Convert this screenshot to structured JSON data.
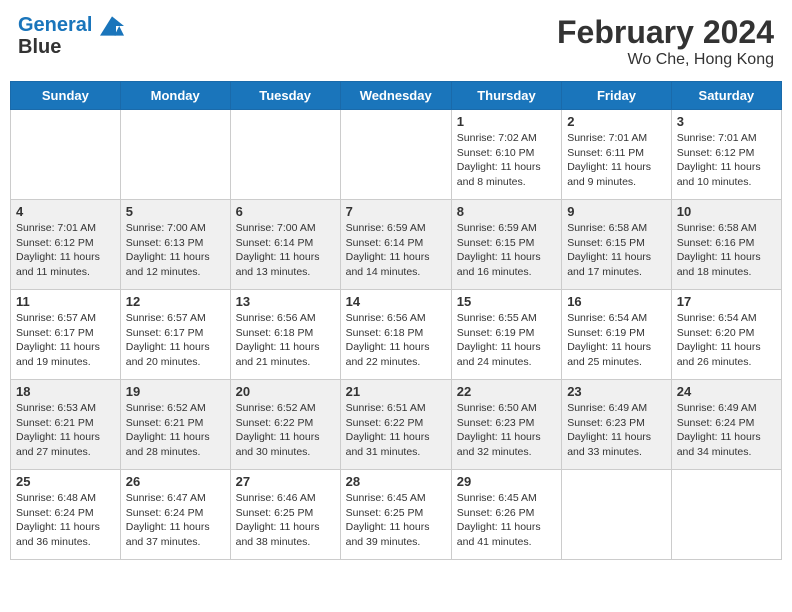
{
  "header": {
    "logo_line1": "General",
    "logo_line2": "Blue",
    "month_year": "February 2024",
    "location": "Wo Che, Hong Kong"
  },
  "days_of_week": [
    "Sunday",
    "Monday",
    "Tuesday",
    "Wednesday",
    "Thursday",
    "Friday",
    "Saturday"
  ],
  "weeks": [
    [
      {
        "num": "",
        "info": ""
      },
      {
        "num": "",
        "info": ""
      },
      {
        "num": "",
        "info": ""
      },
      {
        "num": "",
        "info": ""
      },
      {
        "num": "1",
        "info": "Sunrise: 7:02 AM\nSunset: 6:10 PM\nDaylight: 11 hours\nand 8 minutes."
      },
      {
        "num": "2",
        "info": "Sunrise: 7:01 AM\nSunset: 6:11 PM\nDaylight: 11 hours\nand 9 minutes."
      },
      {
        "num": "3",
        "info": "Sunrise: 7:01 AM\nSunset: 6:12 PM\nDaylight: 11 hours\nand 10 minutes."
      }
    ],
    [
      {
        "num": "4",
        "info": "Sunrise: 7:01 AM\nSunset: 6:12 PM\nDaylight: 11 hours\nand 11 minutes."
      },
      {
        "num": "5",
        "info": "Sunrise: 7:00 AM\nSunset: 6:13 PM\nDaylight: 11 hours\nand 12 minutes."
      },
      {
        "num": "6",
        "info": "Sunrise: 7:00 AM\nSunset: 6:14 PM\nDaylight: 11 hours\nand 13 minutes."
      },
      {
        "num": "7",
        "info": "Sunrise: 6:59 AM\nSunset: 6:14 PM\nDaylight: 11 hours\nand 14 minutes."
      },
      {
        "num": "8",
        "info": "Sunrise: 6:59 AM\nSunset: 6:15 PM\nDaylight: 11 hours\nand 16 minutes."
      },
      {
        "num": "9",
        "info": "Sunrise: 6:58 AM\nSunset: 6:15 PM\nDaylight: 11 hours\nand 17 minutes."
      },
      {
        "num": "10",
        "info": "Sunrise: 6:58 AM\nSunset: 6:16 PM\nDaylight: 11 hours\nand 18 minutes."
      }
    ],
    [
      {
        "num": "11",
        "info": "Sunrise: 6:57 AM\nSunset: 6:17 PM\nDaylight: 11 hours\nand 19 minutes."
      },
      {
        "num": "12",
        "info": "Sunrise: 6:57 AM\nSunset: 6:17 PM\nDaylight: 11 hours\nand 20 minutes."
      },
      {
        "num": "13",
        "info": "Sunrise: 6:56 AM\nSunset: 6:18 PM\nDaylight: 11 hours\nand 21 minutes."
      },
      {
        "num": "14",
        "info": "Sunrise: 6:56 AM\nSunset: 6:18 PM\nDaylight: 11 hours\nand 22 minutes."
      },
      {
        "num": "15",
        "info": "Sunrise: 6:55 AM\nSunset: 6:19 PM\nDaylight: 11 hours\nand 24 minutes."
      },
      {
        "num": "16",
        "info": "Sunrise: 6:54 AM\nSunset: 6:19 PM\nDaylight: 11 hours\nand 25 minutes."
      },
      {
        "num": "17",
        "info": "Sunrise: 6:54 AM\nSunset: 6:20 PM\nDaylight: 11 hours\nand 26 minutes."
      }
    ],
    [
      {
        "num": "18",
        "info": "Sunrise: 6:53 AM\nSunset: 6:21 PM\nDaylight: 11 hours\nand 27 minutes."
      },
      {
        "num": "19",
        "info": "Sunrise: 6:52 AM\nSunset: 6:21 PM\nDaylight: 11 hours\nand 28 minutes."
      },
      {
        "num": "20",
        "info": "Sunrise: 6:52 AM\nSunset: 6:22 PM\nDaylight: 11 hours\nand 30 minutes."
      },
      {
        "num": "21",
        "info": "Sunrise: 6:51 AM\nSunset: 6:22 PM\nDaylight: 11 hours\nand 31 minutes."
      },
      {
        "num": "22",
        "info": "Sunrise: 6:50 AM\nSunset: 6:23 PM\nDaylight: 11 hours\nand 32 minutes."
      },
      {
        "num": "23",
        "info": "Sunrise: 6:49 AM\nSunset: 6:23 PM\nDaylight: 11 hours\nand 33 minutes."
      },
      {
        "num": "24",
        "info": "Sunrise: 6:49 AM\nSunset: 6:24 PM\nDaylight: 11 hours\nand 34 minutes."
      }
    ],
    [
      {
        "num": "25",
        "info": "Sunrise: 6:48 AM\nSunset: 6:24 PM\nDaylight: 11 hours\nand 36 minutes."
      },
      {
        "num": "26",
        "info": "Sunrise: 6:47 AM\nSunset: 6:24 PM\nDaylight: 11 hours\nand 37 minutes."
      },
      {
        "num": "27",
        "info": "Sunrise: 6:46 AM\nSunset: 6:25 PM\nDaylight: 11 hours\nand 38 minutes."
      },
      {
        "num": "28",
        "info": "Sunrise: 6:45 AM\nSunset: 6:25 PM\nDaylight: 11 hours\nand 39 minutes."
      },
      {
        "num": "29",
        "info": "Sunrise: 6:45 AM\nSunset: 6:26 PM\nDaylight: 11 hours\nand 41 minutes."
      },
      {
        "num": "",
        "info": ""
      },
      {
        "num": "",
        "info": ""
      }
    ]
  ]
}
